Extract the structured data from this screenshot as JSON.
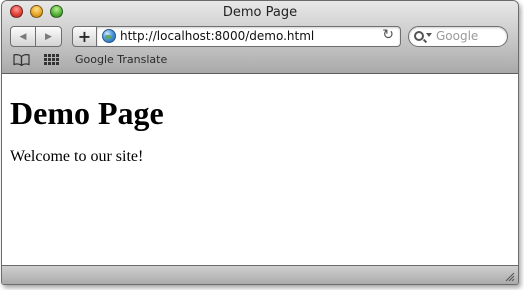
{
  "window": {
    "title": "Demo Page"
  },
  "toolbar": {
    "back_icon": "◀",
    "forward_icon": "▶",
    "add_bookmark_icon": "+",
    "reload_icon": "↻"
  },
  "address_bar": {
    "url": "http://localhost:8000/demo.html",
    "favicon": "globe-icon"
  },
  "search": {
    "placeholder": "Google"
  },
  "bookmarks_bar": {
    "items": [
      {
        "label": "Google Translate"
      }
    ]
  },
  "page": {
    "heading": "Demo Page",
    "body_text": "Welcome to our site!"
  }
}
